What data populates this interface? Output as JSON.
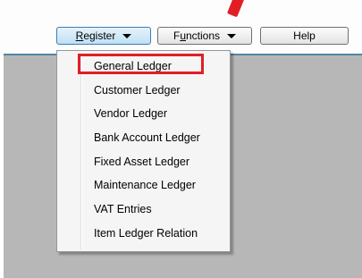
{
  "toolbar": {
    "register": {
      "label_prefix": "",
      "label_mnemonic": "R",
      "label_rest": "egister"
    },
    "functions": {
      "label_prefix": "F",
      "label_mnemonic": "u",
      "label_rest": "nctions"
    },
    "help": {
      "label": "Help"
    }
  },
  "register_menu": {
    "items": [
      {
        "label": "General Ledger"
      },
      {
        "label": "Customer Ledger"
      },
      {
        "label": "Vendor Ledger"
      },
      {
        "label": "Bank Account Ledger"
      },
      {
        "label": "Fixed Asset Ledger"
      },
      {
        "label": "Maintenance Ledger"
      },
      {
        "label": "VAT Entries"
      },
      {
        "label": "Item Ledger Relation"
      }
    ]
  },
  "colors": {
    "annotation": "#e11e26",
    "content_background": "#b7b7b7",
    "active_button": "#bfe0f5"
  }
}
